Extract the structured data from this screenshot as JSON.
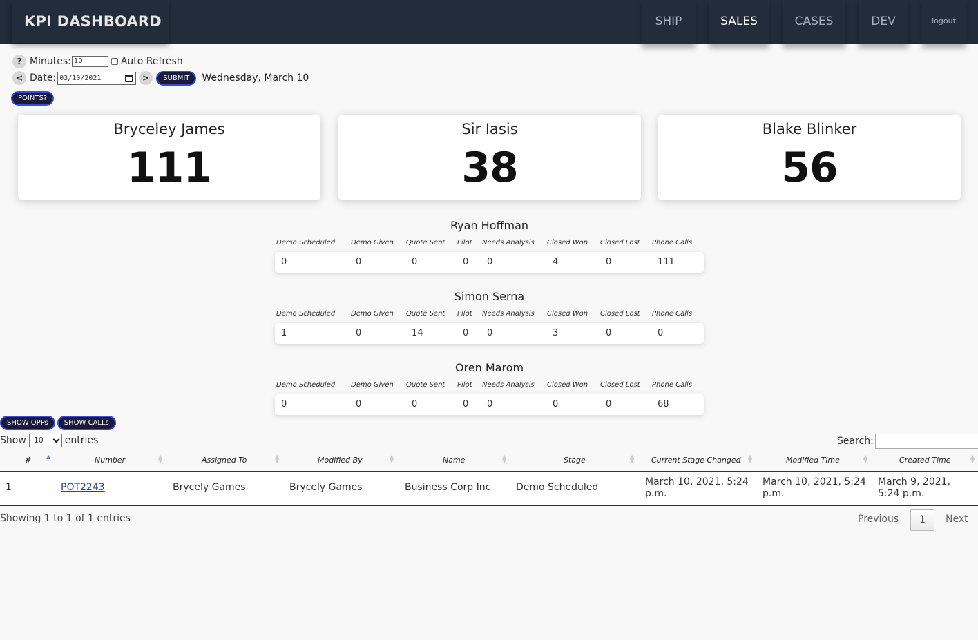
{
  "header": {
    "title": "KPI DASHBOARD",
    "nav": [
      {
        "label": "SHIP",
        "active": false
      },
      {
        "label": "SALES",
        "active": true
      },
      {
        "label": "CASES",
        "active": false
      },
      {
        "label": "DEV",
        "active": false
      },
      {
        "label": "logout",
        "active": false
      }
    ]
  },
  "controls": {
    "help_label": "?",
    "minutes_label": "Minutes:",
    "minutes_value": "10",
    "auto_refresh_label": "Auto Refresh",
    "prev_label": "<",
    "date_label": "Date:",
    "date_value": "03/10/2021",
    "next_label": ">",
    "submit_label": "SUBMIT",
    "date_text": "Wednesday, March 10",
    "points_label": "POINTS?"
  },
  "cards": [
    {
      "name": "Bryceley James",
      "value": "111"
    },
    {
      "name": "Sir Iasis",
      "value": "38"
    },
    {
      "name": "Blake Blinker",
      "value": "56"
    }
  ],
  "kpi_columns": [
    "Demo Scheduled",
    "Demo Given",
    "Quote Sent",
    "Pilot",
    "Needs Analysis",
    "Closed Won",
    "Closed Lost",
    "Phone Calls"
  ],
  "people": [
    {
      "name": "Ryan Hoffman",
      "values": [
        "0",
        "0",
        "0",
        "0",
        "0",
        "4",
        "0",
        "111"
      ]
    },
    {
      "name": "Simon Serna",
      "values": [
        "1",
        "0",
        "14",
        "0",
        "0",
        "3",
        "0",
        "0"
      ]
    },
    {
      "name": "Oren Marom",
      "values": [
        "0",
        "0",
        "0",
        "0",
        "0",
        "0",
        "0",
        "68"
      ]
    }
  ],
  "table": {
    "show_opps_label": "SHOW OPPs",
    "show_calls_label": "SHOW CALLs",
    "show_label": "Show",
    "entries_value": "10",
    "entries_label": "entries",
    "search_label": "Search:",
    "columns": [
      "#",
      "Number",
      "Assigned To",
      "Modified By",
      "Name",
      "Stage",
      "Current Stage Changed",
      "Modified Time",
      "Created Time"
    ],
    "rows": [
      {
        "index": "1",
        "number": "POT2243",
        "assigned_to": "Brycely Games",
        "modified_by": "Brycely Games",
        "name": "Business Corp Inc",
        "stage": "Demo Scheduled",
        "current_stage_changed": "March 10, 2021, 5:24 p.m.",
        "modified_time": "March 10, 2021, 5:24 p.m.",
        "created_time": "March 9, 2021, 5:24 p.m."
      }
    ],
    "info": "Showing 1 to 1 of 1 entries",
    "previous_label": "Previous",
    "page": "1",
    "next_label": "Next"
  }
}
